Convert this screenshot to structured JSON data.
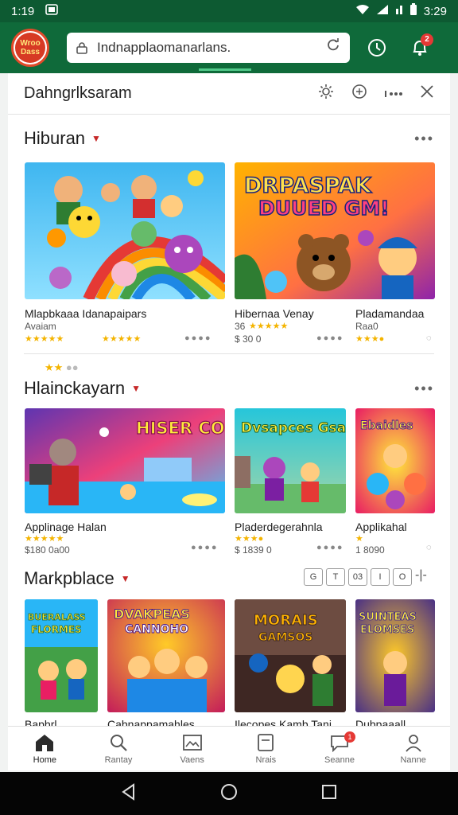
{
  "status": {
    "time_left": "1:19",
    "time_right": "3:29"
  },
  "appbar": {
    "logo_text": "Wroo Dass",
    "url": "Indnapplaomanarlans.",
    "notification_count": "2"
  },
  "page": {
    "title": "Dahngrlksaram"
  },
  "sections": [
    {
      "name": "Hiburan",
      "items": [
        {
          "title": "Mlapbkaaa Idanapaipars",
          "sub": "Avaiam",
          "meta": ""
        },
        {
          "title": "Hibernaa Venay",
          "sub": "36",
          "meta": "$ 30 0"
        },
        {
          "title": "Pladamandaa",
          "sub": "Raa0",
          "meta": ""
        }
      ],
      "banner_text": "DRPASPAK DUUED GM!"
    },
    {
      "name": "Hlainckayarn",
      "items": [
        {
          "title": "Applinage Halan",
          "sub": "",
          "meta": "$180 0a00"
        },
        {
          "title": "Pladerdegerahnla",
          "sub": "",
          "meta": "$ 1839 0"
        },
        {
          "title": "Applikahal",
          "sub": "",
          "meta": "1 8090"
        }
      ],
      "banner_texts": [
        "HISER COMLES",
        "Dvsapces Gsamhes",
        "Ebaidles"
      ]
    },
    {
      "name": "Markpblace",
      "items": [
        {
          "title": "Bapbrl",
          "banner": "BUERALASS FLORMES"
        },
        {
          "title": "Cabnappamahles",
          "banner": "DVAKPEAS CANNOHO"
        },
        {
          "title": "Ilecopes Kamb Tani",
          "banner": "MORAIS GAMSOS"
        },
        {
          "title": "Dubpaaall",
          "banner": "SUINTEAS ELOMSES"
        }
      ],
      "filters": [
        "G",
        "T",
        "03",
        "I",
        "O"
      ]
    }
  ],
  "bottom_nav": {
    "items": [
      {
        "label": "Home",
        "icon": "home-icon"
      },
      {
        "label": "Rantay",
        "icon": "search-icon"
      },
      {
        "label": "Vaens",
        "icon": "image-icon"
      },
      {
        "label": "Nrais",
        "icon": "document-icon"
      },
      {
        "label": "Seanne",
        "icon": "chat-icon"
      },
      {
        "label": "Nanne",
        "icon": "person-icon"
      }
    ],
    "chat_badge": "1"
  },
  "colors": {
    "appbar": "#0f6a3a",
    "status": "#0d5a32",
    "accent_red": "#c62828",
    "star": "#f4b400"
  }
}
